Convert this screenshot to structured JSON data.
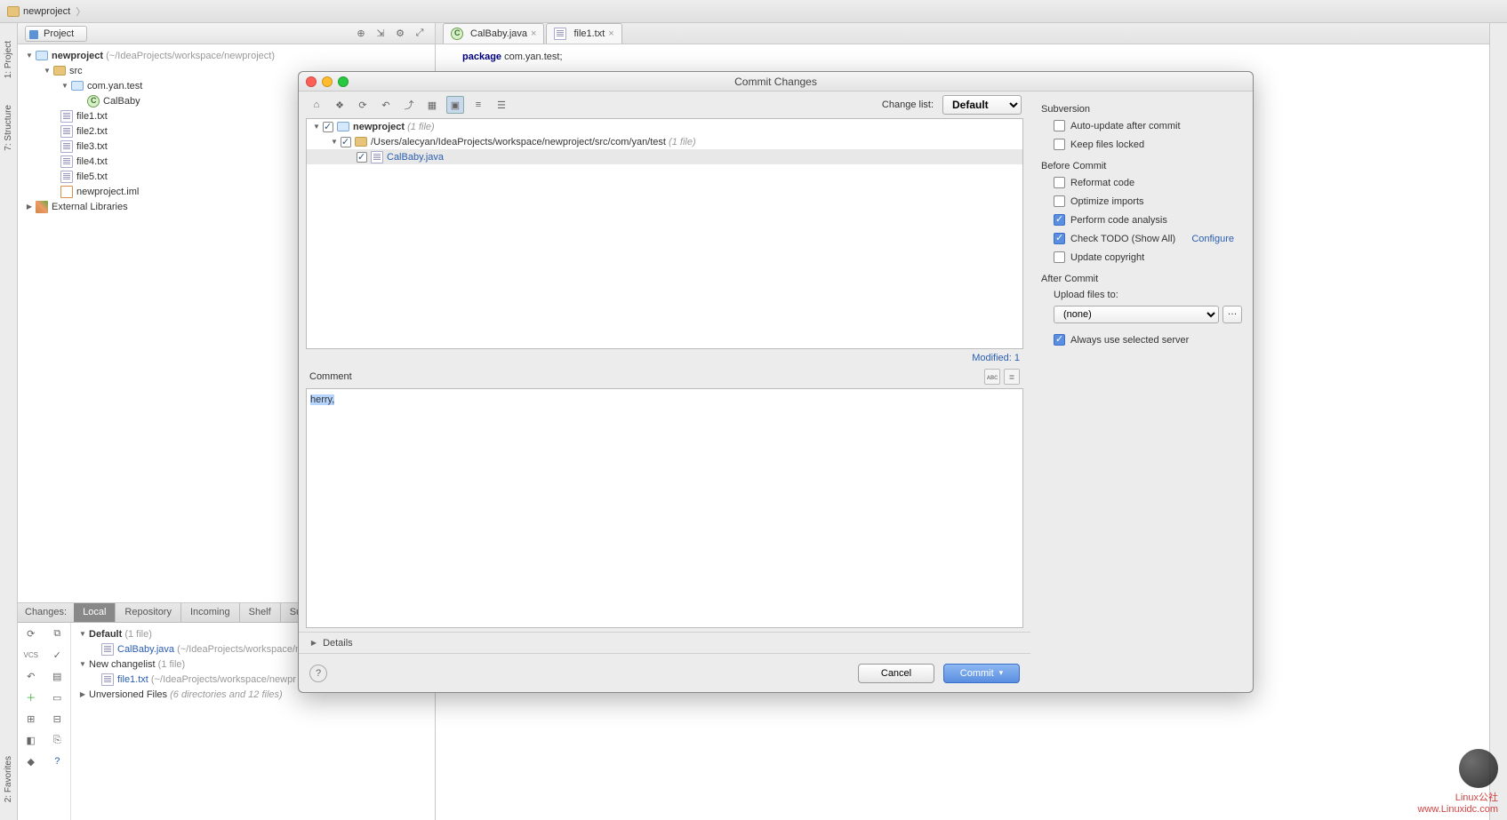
{
  "breadcrumb": {
    "project": "newproject"
  },
  "project_panel": {
    "title": "Project",
    "root": "newproject",
    "root_hint": "(~/IdeaProjects/workspace/newproject)",
    "src": "src",
    "pkg": "com.yan.test",
    "cls": "CalBaby",
    "files": [
      "file1.txt",
      "file2.txt",
      "file3.txt",
      "file4.txt",
      "file5.txt"
    ],
    "iml": "newproject.iml",
    "ext_lib": "External Libraries"
  },
  "side_tabs": {
    "project": "1: Project",
    "structure": "7: Structure",
    "favorites": "2: Favorites"
  },
  "editor": {
    "tabs": [
      {
        "icon": "class",
        "label": "CalBaby.java"
      },
      {
        "icon": "txt",
        "label": "file1.txt"
      }
    ],
    "code_kw": "package",
    "code_rest": " com.yan.test;"
  },
  "changes": {
    "label": "Changes:",
    "tabs": [
      "Local",
      "Repository",
      "Incoming",
      "Shelf",
      "Subversion W"
    ],
    "active": 0,
    "default_name": "Default",
    "default_hint": "(1 file)",
    "default_file": "CalBaby.java",
    "default_file_hint": "(~/IdeaProjects/workspace/n",
    "newcl_name": "New changelist",
    "newcl_hint": "(1 file)",
    "newcl_file": "file1.txt",
    "newcl_file_hint": "(~/IdeaProjects/workspace/newpr",
    "unversioned": "Unversioned Files",
    "unversioned_hint": "(6 directories and 12 files)",
    "vcs": "VCS"
  },
  "dialog": {
    "title": "Commit Changes",
    "changelist_label": "Change list:",
    "changelist_value": "Default",
    "tree": {
      "root": "newproject",
      "root_hint": "(1 file)",
      "path": "/Users/alecyan/IdeaProjects/workspace/newproject/src/com/yan/test",
      "path_hint": "(1 file)",
      "file": "CalBaby.java"
    },
    "modified": "Modified: 1",
    "comment_label": "Comment",
    "comment_text": "herry,",
    "details": "Details",
    "cancel": "Cancel",
    "commit": "Commit",
    "right": {
      "subversion": "Subversion",
      "auto_update": "Auto-update after commit",
      "keep_locked": "Keep files locked",
      "before": "Before Commit",
      "reformat": "Reformat code",
      "optimize": "Optimize imports",
      "analysis": "Perform code analysis",
      "todo": "Check TODO (Show All)",
      "configure": "Configure",
      "copyright": "Update copyright",
      "after": "After Commit",
      "upload": "Upload files to:",
      "upload_value": "(none)",
      "always": "Always use selected server"
    }
  },
  "watermark": {
    "l1": "Linux公社",
    "l2": "www.Linuxidc.com"
  }
}
